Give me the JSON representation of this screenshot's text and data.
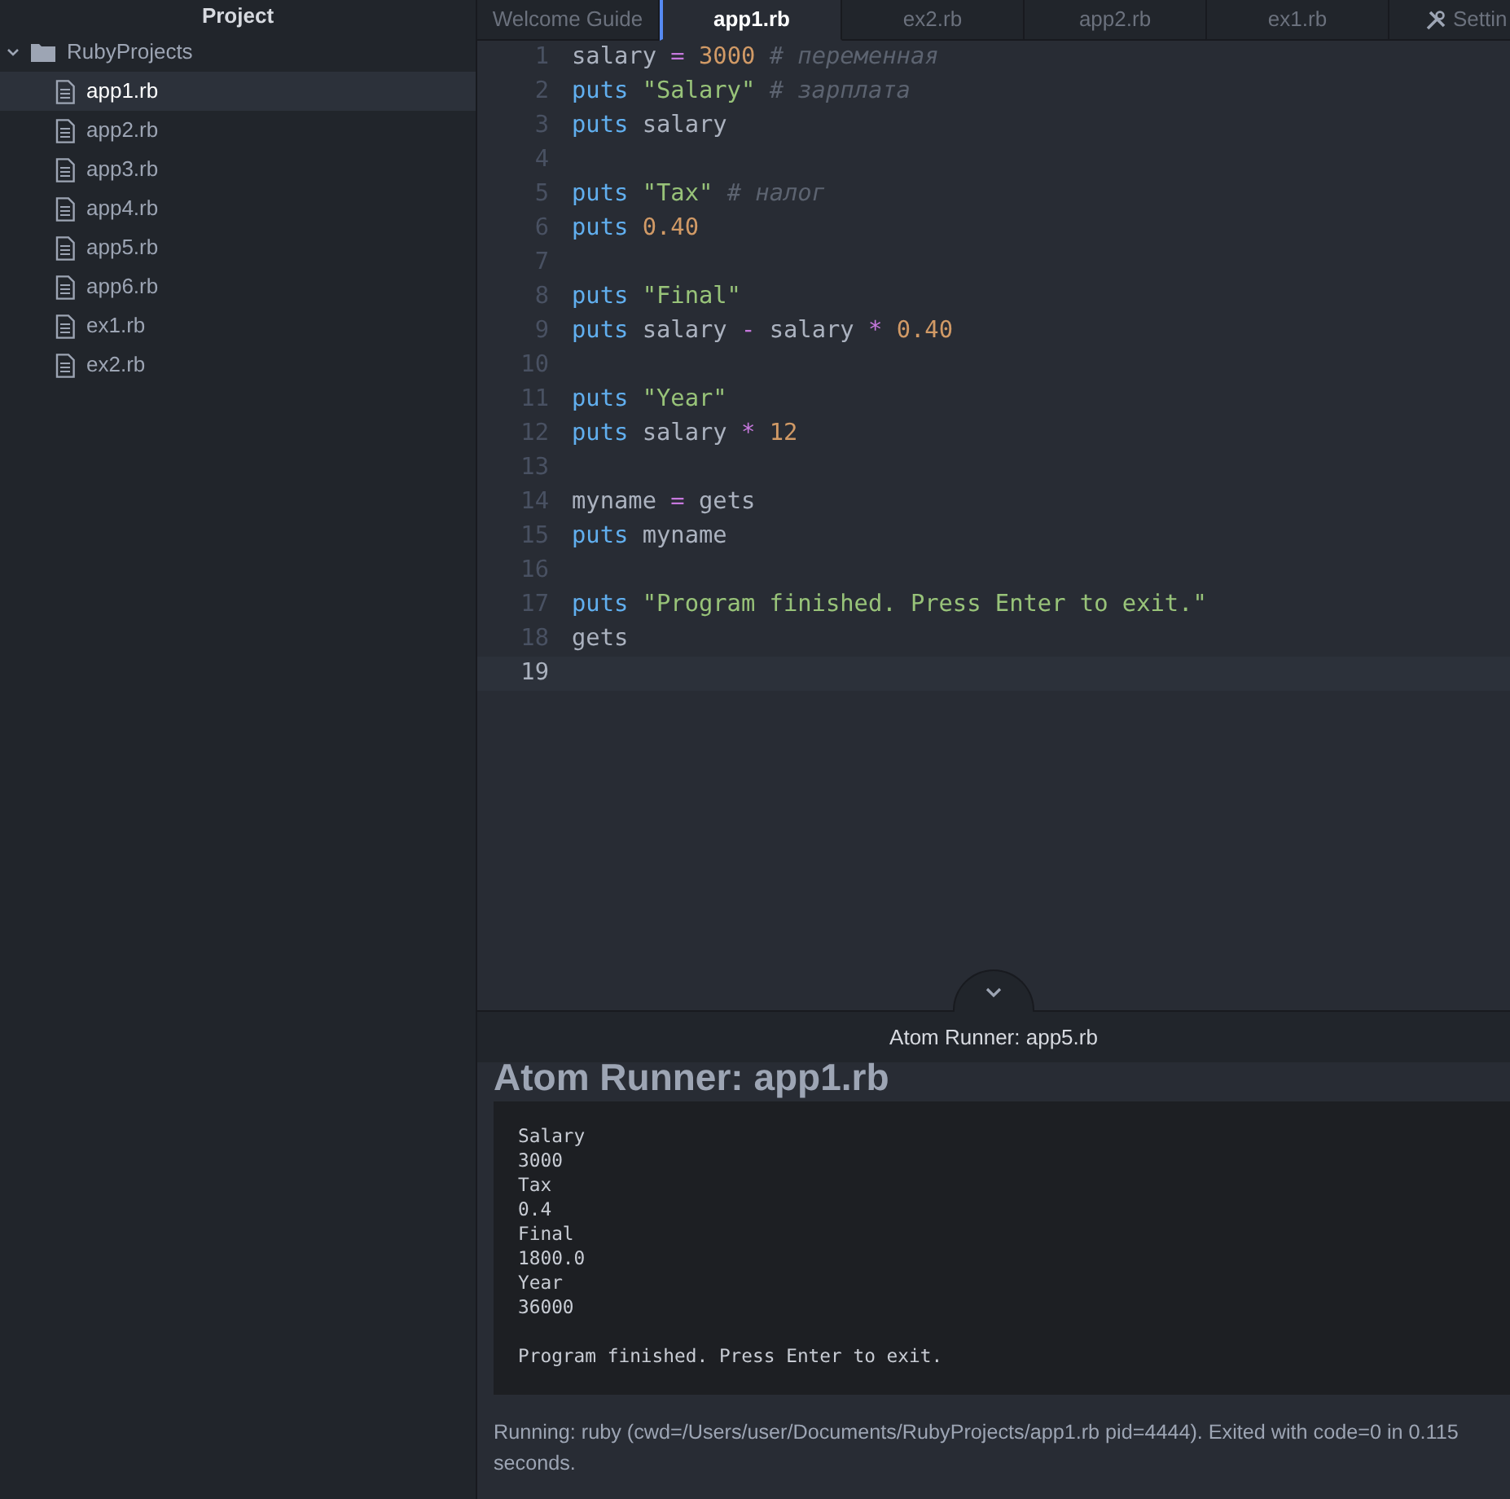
{
  "sidebar": {
    "title": "Project",
    "tree": [
      {
        "label": "RubyProjects",
        "kind": "folder",
        "expanded": true,
        "selected": false,
        "children": [
          {
            "label": "app1.rb",
            "kind": "file",
            "selected": true
          },
          {
            "label": "app2.rb",
            "kind": "file",
            "selected": false
          },
          {
            "label": "app3.rb",
            "kind": "file",
            "selected": false
          },
          {
            "label": "app4.rb",
            "kind": "file",
            "selected": false
          },
          {
            "label": "app5.rb",
            "kind": "file",
            "selected": false
          },
          {
            "label": "app6.rb",
            "kind": "file",
            "selected": false
          },
          {
            "label": "ex1.rb",
            "kind": "file",
            "selected": false
          },
          {
            "label": "ex2.rb",
            "kind": "file",
            "selected": false
          }
        ]
      }
    ]
  },
  "tabs": [
    {
      "label": "Welcome Guide",
      "kind": "plain",
      "selected": false
    },
    {
      "label": "app1.rb",
      "kind": "plain",
      "selected": true
    },
    {
      "label": "ex2.rb",
      "kind": "plain",
      "selected": false
    },
    {
      "label": "app2.rb",
      "kind": "plain",
      "selected": false
    },
    {
      "label": "ex1.rb",
      "kind": "plain",
      "selected": false
    },
    {
      "label": "Settin",
      "kind": "settings",
      "selected": false
    }
  ],
  "editor": {
    "lines": [
      {
        "number": "1",
        "current": false,
        "tokens": [
          {
            "kind": "plain",
            "text": "salary"
          },
          {
            "kind": "operator",
            "text": "="
          },
          {
            "kind": "number",
            "text": "3000"
          },
          {
            "kind": "comment",
            "text": "# переменная"
          }
        ]
      },
      {
        "number": "2",
        "current": false,
        "tokens": [
          {
            "kind": "keyword",
            "text": "puts"
          },
          {
            "kind": "string",
            "text": "\"Salary\""
          },
          {
            "kind": "comment",
            "text": "# зарплата"
          }
        ]
      },
      {
        "number": "3",
        "current": false,
        "tokens": [
          {
            "kind": "keyword",
            "text": "puts"
          },
          {
            "kind": "plain",
            "text": "salary"
          }
        ]
      },
      {
        "number": "4",
        "current": false
      },
      {
        "number": "5",
        "current": false,
        "tokens": [
          {
            "kind": "keyword",
            "text": "puts"
          },
          {
            "kind": "string",
            "text": "\"Tax\""
          },
          {
            "kind": "comment",
            "text": "# налог"
          }
        ]
      },
      {
        "number": "6",
        "current": false,
        "tokens": [
          {
            "kind": "keyword",
            "text": "puts"
          },
          {
            "kind": "number",
            "text": "0.40"
          }
        ]
      },
      {
        "number": "7",
        "current": false
      },
      {
        "number": "8",
        "current": false,
        "tokens": [
          {
            "kind": "keyword",
            "text": "puts"
          },
          {
            "kind": "string",
            "text": "\"Final\""
          }
        ]
      },
      {
        "number": "9",
        "current": false,
        "tokens": [
          {
            "kind": "keyword",
            "text": "puts"
          },
          {
            "kind": "plain",
            "text": "salary"
          },
          {
            "kind": "operator",
            "text": "-"
          },
          {
            "kind": "plain",
            "text": "salary"
          },
          {
            "kind": "operator",
            "text": "*"
          },
          {
            "kind": "number",
            "text": "0.40"
          }
        ]
      },
      {
        "number": "10",
        "current": false
      },
      {
        "number": "11",
        "current": false,
        "tokens": [
          {
            "kind": "keyword",
            "text": "puts"
          },
          {
            "kind": "string",
            "text": "\"Year\""
          }
        ]
      },
      {
        "number": "12",
        "current": false,
        "tokens": [
          {
            "kind": "keyword",
            "text": "puts"
          },
          {
            "kind": "plain",
            "text": "salary"
          },
          {
            "kind": "operator",
            "text": "*"
          },
          {
            "kind": "number",
            "text": "12"
          }
        ]
      },
      {
        "number": "13",
        "current": false
      },
      {
        "number": "14",
        "current": false,
        "tokens": [
          {
            "kind": "plain",
            "text": "myname"
          },
          {
            "kind": "operator",
            "text": "="
          },
          {
            "kind": "plain",
            "text": "gets"
          }
        ]
      },
      {
        "number": "15",
        "current": false,
        "tokens": [
          {
            "kind": "keyword",
            "text": "puts"
          },
          {
            "kind": "plain",
            "text": "myname"
          }
        ]
      },
      {
        "number": "16",
        "current": false
      },
      {
        "number": "17",
        "current": false,
        "tokens": [
          {
            "kind": "keyword",
            "text": "puts"
          },
          {
            "kind": "string",
            "text": "\"Program finished. Press Enter to exit.\""
          }
        ]
      },
      {
        "number": "18",
        "current": false,
        "tokens": [
          {
            "kind": "plain",
            "text": "gets"
          }
        ]
      },
      {
        "number": "19",
        "current": true
      }
    ]
  },
  "runner": {
    "panel_title": "Atom Runner: app5.rb",
    "heading": "Atom Runner: app1.rb",
    "output": [
      {
        "lines": [
          "Salary",
          "3000",
          "Tax",
          "0.4",
          "Final",
          "1800.0",
          "Year",
          "36000"
        ]
      },
      {
        "lines": [
          "Program finished. Press Enter to exit."
        ]
      }
    ],
    "status": "Running: ruby (cwd=/Users/user/Documents/RubyProjects/app1.rb pid=4444). Exited with code=0 in 0.115 seconds."
  }
}
